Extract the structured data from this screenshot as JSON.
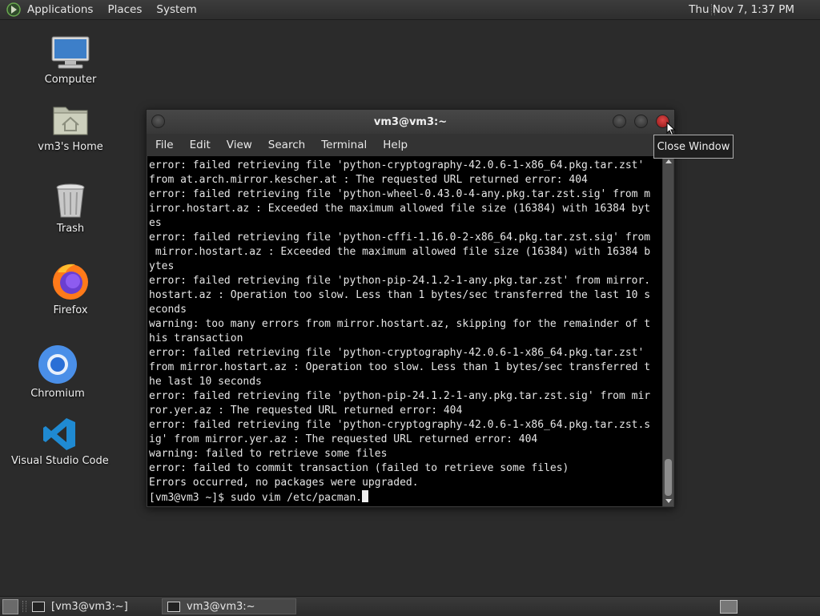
{
  "top_panel": {
    "menus": [
      "Applications",
      "Places",
      "System"
    ],
    "clock": "Thu Nov 7, 1:37 PM"
  },
  "desktop": {
    "icons": [
      {
        "label": "Computer",
        "icon": "computer-icon"
      },
      {
        "label": "vm3's Home",
        "icon": "home-folder-icon"
      },
      {
        "label": "Trash",
        "icon": "trash-icon"
      },
      {
        "label": "Firefox",
        "icon": "firefox-icon"
      },
      {
        "label": "Chromium",
        "icon": "chromium-icon"
      },
      {
        "label": "Visual Studio Code",
        "icon": "vscode-icon"
      }
    ]
  },
  "terminal": {
    "title": "vm3@vm3:~",
    "menu": [
      "File",
      "Edit",
      "View",
      "Search",
      "Terminal",
      "Help"
    ],
    "lines": [
      "error: failed retrieving file 'python-cryptography-42.0.6-1-x86_64.pkg.tar.zst'",
      "from at.arch.mirror.kescher.at : The requested URL returned error: 404",
      "error: failed retrieving file 'python-wheel-0.43.0-4-any.pkg.tar.zst.sig' from m",
      "irror.hostart.az : Exceeded the maximum allowed file size (16384) with 16384 byt",
      "es",
      "error: failed retrieving file 'python-cffi-1.16.0-2-x86_64.pkg.tar.zst.sig' from",
      " mirror.hostart.az : Exceeded the maximum allowed file size (16384) with 16384 b",
      "ytes",
      "error: failed retrieving file 'python-pip-24.1.2-1-any.pkg.tar.zst' from mirror.",
      "hostart.az : Operation too slow. Less than 1 bytes/sec transferred the last 10 s",
      "econds",
      "warning: too many errors from mirror.hostart.az, skipping for the remainder of t",
      "his transaction",
      "error: failed retrieving file 'python-cryptography-42.0.6-1-x86_64.pkg.tar.zst'",
      "from mirror.hostart.az : Operation too slow. Less than 1 bytes/sec transferred t",
      "he last 10 seconds",
      "error: failed retrieving file 'python-pip-24.1.2-1-any.pkg.tar.zst.sig' from mir",
      "ror.yer.az : The requested URL returned error: 404",
      "error: failed retrieving file 'python-cryptography-42.0.6-1-x86_64.pkg.tar.zst.s",
      "ig' from mirror.yer.az : The requested URL returned error: 404",
      "warning: failed to retrieve some files",
      "error: failed to commit transaction (failed to retrieve some files)",
      "Errors occurred, no packages were upgraded."
    ],
    "prompt": "[vm3@vm3 ~]$ sudo vim /etc/pacman."
  },
  "tooltip": "Close Window",
  "taskbar": {
    "tasks": [
      "[vm3@vm3:~]",
      "vm3@vm3:~"
    ]
  }
}
